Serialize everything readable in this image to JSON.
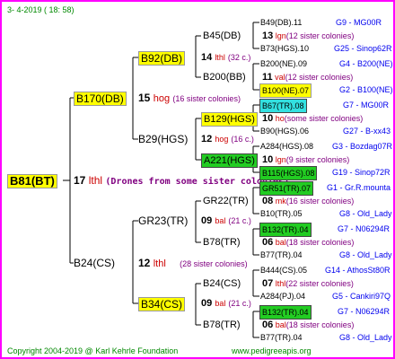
{
  "header": {
    "date": "3-  4-2019  ( 18:  58)"
  },
  "footer": {
    "copyright": "Copyright 2004-2019 @ Karl Kehrle Foundation",
    "site": "www.pedigreeapis.org"
  },
  "root": {
    "label": "B81(BT)",
    "num": "17",
    "pre": "lthl",
    "note": "(Drones from some sister colonies)"
  },
  "g1": [
    {
      "label": "B170(DB)",
      "num": "15",
      "pre": "hog",
      "note": "(16 sister colonies)"
    },
    {
      "label": "B24(CS)",
      "num": "12",
      "pre": "lthl",
      "note": "(28 sister colonies)"
    }
  ],
  "g2": [
    {
      "label": "B92(DB)",
      "num": "14",
      "pre": "lthl",
      "note": "(32 c.)"
    },
    {
      "label": "B29(HGS)",
      "num": "12",
      "pre": "hog",
      "note": "(16 c.)"
    },
    {
      "label": "GR23(TR)",
      "num": "09",
      "pre": "bal",
      "note": "(21 c.)"
    },
    {
      "label": "B34(CS)",
      "num": "09",
      "pre": "bal",
      "note": "(21 c.)"
    }
  ],
  "g3": [
    {
      "label": "B45(DB)"
    },
    {
      "label": "B200(BB)"
    },
    {
      "label": "B129(HGS)"
    },
    {
      "label": "A221(HGS)"
    },
    {
      "label": "GR22(TR)"
    },
    {
      "label": "B78(TR)"
    },
    {
      "label": "B24(CS)"
    },
    {
      "label": "B78(TR)"
    }
  ],
  "g4": [
    {
      "top": "B49(DB).11",
      "num": "13",
      "pre": "lgn",
      "note": "(12 sister colonies)",
      "bot": "B73(HGS).10",
      "rtop": "G9 - MG00R",
      "rbot": "G25 - Sinop62R"
    },
    {
      "top": "B200(NE).09",
      "num": "11",
      "pre": "val",
      "note": "(12 sister colonies)",
      "bot": "B100(NE).07",
      "rtop": "G4 - B200(NE)",
      "rbot": "G2 - B100(NE)"
    },
    {
      "top": "B67(TR).08",
      "num": "10",
      "pre": "ho",
      "note": "(some sister colonies)",
      "bot": "B90(HGS).06",
      "rtop": "G7 - MG00R",
      "rbot": "G27 - B-xx43"
    },
    {
      "top": "A284(HGS).08",
      "num": "10",
      "pre": "lgn",
      "note": "(9 sister colonies)",
      "bot": "B115(HGS).08",
      "rtop": "G3 - Bozdag07R",
      "rbot": "G19 - Sinop72R"
    },
    {
      "top": "GR51(TR).07",
      "num": "08",
      "pre": "mk",
      "note": "(16 sister colonies)",
      "bot": "B10(TR).05",
      "rtop": "G1 - Gr.R.mounta",
      "rbot": "G8 - Old_Lady"
    },
    {
      "top": "B132(TR).04",
      "num": "06",
      "pre": "bal",
      "note": "(18 sister colonies)",
      "bot": "B77(TR).04",
      "rtop": "G7 - N06294R",
      "rbot": "G8 - Old_Lady"
    },
    {
      "top": "B444(CS).05",
      "num": "07",
      "pre": "lthl",
      "note": "(22 sister colonies)",
      "bot": "A284(PJ).04",
      "rtop": "G14 - AthosSt80R",
      "rbot": "G5 - Cankiri97Q"
    },
    {
      "top": "B132(TR).04",
      "num": "06",
      "pre": "bal",
      "note": "(18 sister colonies)",
      "bot": "B77(TR).04",
      "rtop": "G7 - N06294R",
      "rbot": "G8 - Old_Lady"
    }
  ]
}
